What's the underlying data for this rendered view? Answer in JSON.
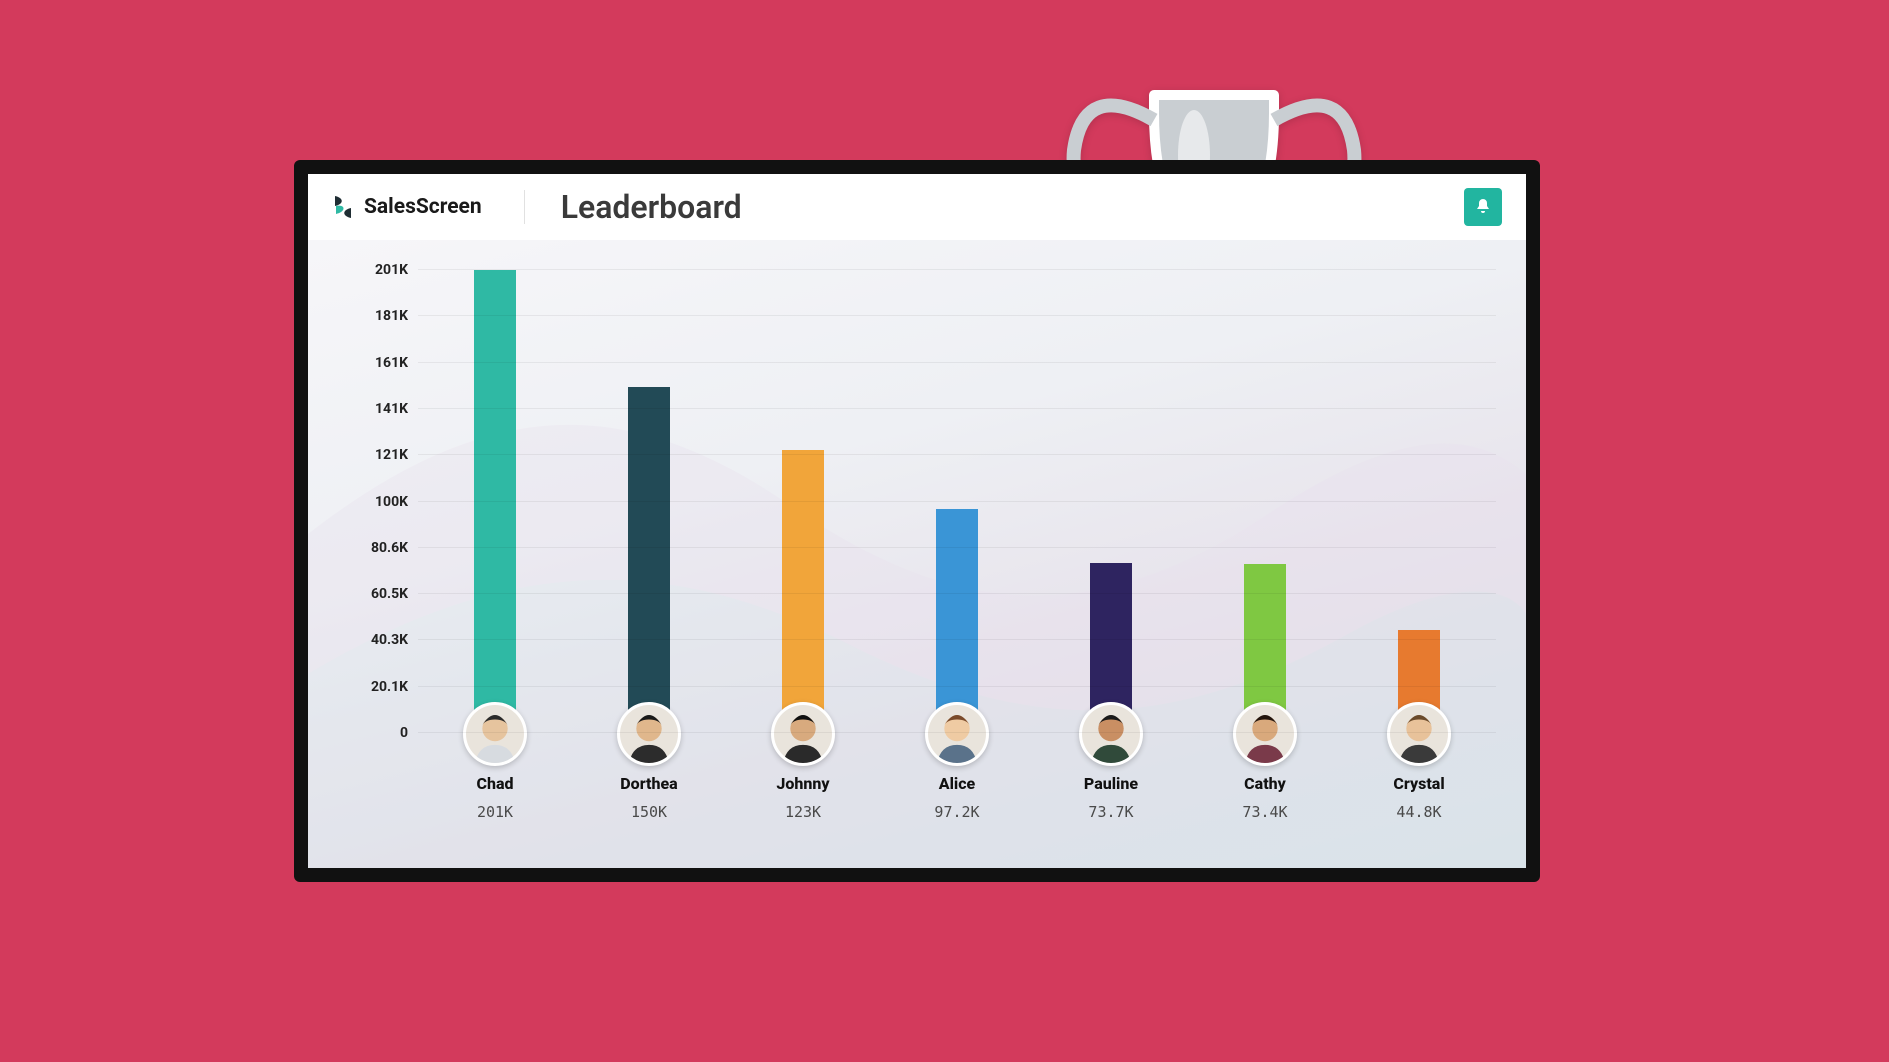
{
  "brand": {
    "name": "SalesScreen"
  },
  "title": "Leaderboard",
  "chart_data": {
    "type": "bar",
    "title": "Leaderboard",
    "xlabel": "",
    "ylabel": "",
    "ylim": [
      0,
      201
    ],
    "y_ticks": [
      "0",
      "20.1K",
      "40.3K",
      "60.5K",
      "80.6K",
      "100K",
      "121K",
      "141K",
      "161K",
      "181K",
      "201K"
    ],
    "categories": [
      "Chad",
      "Dorthea",
      "Johnny",
      "Alice",
      "Pauline",
      "Cathy",
      "Crystal"
    ],
    "values": [
      201,
      150,
      123,
      97.2,
      73.7,
      73.4,
      44.8
    ],
    "value_labels": [
      "201K",
      "150K",
      "123K",
      "97.2K",
      "73.7K",
      "73.4K",
      "44.8K"
    ],
    "colors": [
      "#2fb9a4",
      "#224a56",
      "#f1a53a",
      "#3a95d6",
      "#2e2460",
      "#7fc842",
      "#e77a2f"
    ]
  }
}
